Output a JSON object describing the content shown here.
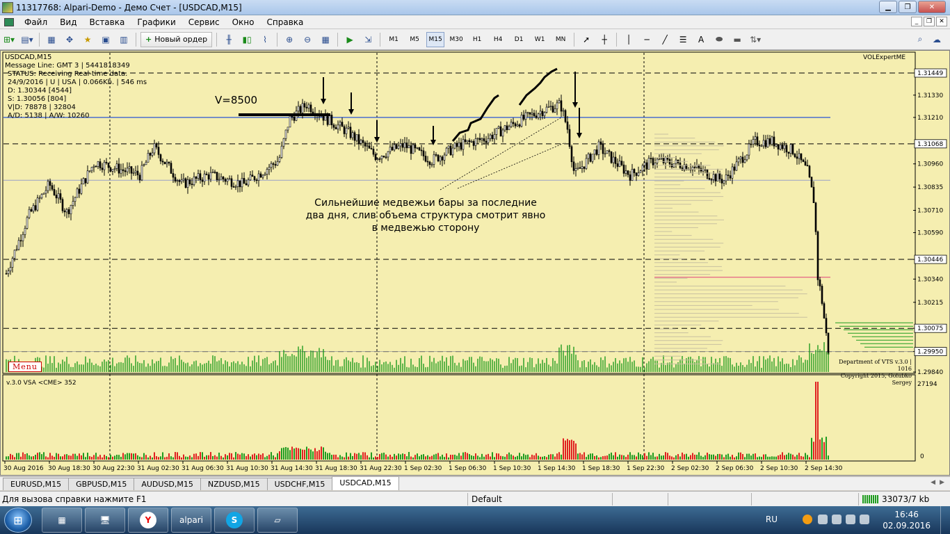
{
  "window": {
    "title": "11317768: Alpari-Demo - Демо Счет - [USDCAD,M15]"
  },
  "menu": [
    "Файл",
    "Вид",
    "Вставка",
    "Графики",
    "Сервис",
    "Окно",
    "Справка"
  ],
  "toolbar": {
    "new_order_label": "Новый ордер",
    "timeframes": [
      "M1",
      "M5",
      "M15",
      "M30",
      "H1",
      "H4",
      "D1",
      "W1",
      "MN"
    ],
    "active_timeframe": "M15"
  },
  "chart": {
    "symbol": "USDCAD,M15",
    "expert": "VOLExpertME",
    "message_line": "Message Line: GMT 3 | 5441818349",
    "info_lines": [
      "STATUS:  Receiving Real-time data.",
      "24/9/2016 | U | USA | 0.066Kb. | 546 ms",
      "D: 1.30344  [4544]",
      "S: 1.30056  [804]",
      "V|D: 78878 | 32804",
      "A/D: 5138 | A/W: 10260"
    ],
    "volume_note": "V=8500",
    "comment_lines": [
      "Сильнейшие медвежьи бары за последние",
      "два дня, слив объема структура смотрит явно",
      "в медвежью сторону"
    ],
    "menu_label": "Menu",
    "copyright_lines": [
      "Department of VTS  v.3.0 | 1016",
      "Copyright 2015, Golubko Sergey"
    ],
    "price_ticks": [
      "1.31449",
      "1.31330",
      "1.31210",
      "1.31068",
      "1.30960",
      "1.30835",
      "1.30710",
      "1.30590",
      "1.30446",
      "1.30340",
      "1.30215",
      "1.30075",
      "1.29950",
      "1.29840"
    ],
    "highlighted_prices": [
      "1.31449",
      "1.31068",
      "1.30446",
      "1.30075",
      "1.29950"
    ],
    "time_ticks": [
      "30 Aug 2016",
      "30 Aug 18:30",
      "30 Aug 22:30",
      "31 Aug 02:30",
      "31 Aug 06:30",
      "31 Aug 10:30",
      "31 Aug 14:30",
      "31 Aug 18:30",
      "31 Aug 22:30",
      "1 Sep 02:30",
      "1 Sep 06:30",
      "1 Sep 10:30",
      "1 Sep 14:30",
      "1 Sep 18:30",
      "1 Sep 22:30",
      "2 Sep 02:30",
      "2 Sep 06:30",
      "2 Sep 10:30",
      "2 Sep 14:30"
    ],
    "indicator_label": "v.3.0 VSA <CME> 352",
    "indicator_max": "27194",
    "indicator_zero": "0",
    "colors": {
      "background": "#f5eeb0",
      "candle": "#000000",
      "volume_up": "#1f9b1f",
      "volume_down": "#e02020",
      "level_blue": "#2a55d4",
      "level_pink": "#e0407a"
    }
  },
  "tabs": [
    "EURUSD,M15",
    "GBPUSD,M15",
    "AUDUSD,M15",
    "NZDUSD,M15",
    "USDCHF,M15",
    "USDCAD,M15"
  ],
  "active_tab": "USDCAD,M15",
  "status": {
    "help": "Для вызова справки нажмите F1",
    "profile": "Default",
    "traffic": "33073/7 kb"
  },
  "taskbar": {
    "lang": "RU",
    "time": "16:46",
    "date": "02.09.2016",
    "alpari_label": "alpari"
  }
}
